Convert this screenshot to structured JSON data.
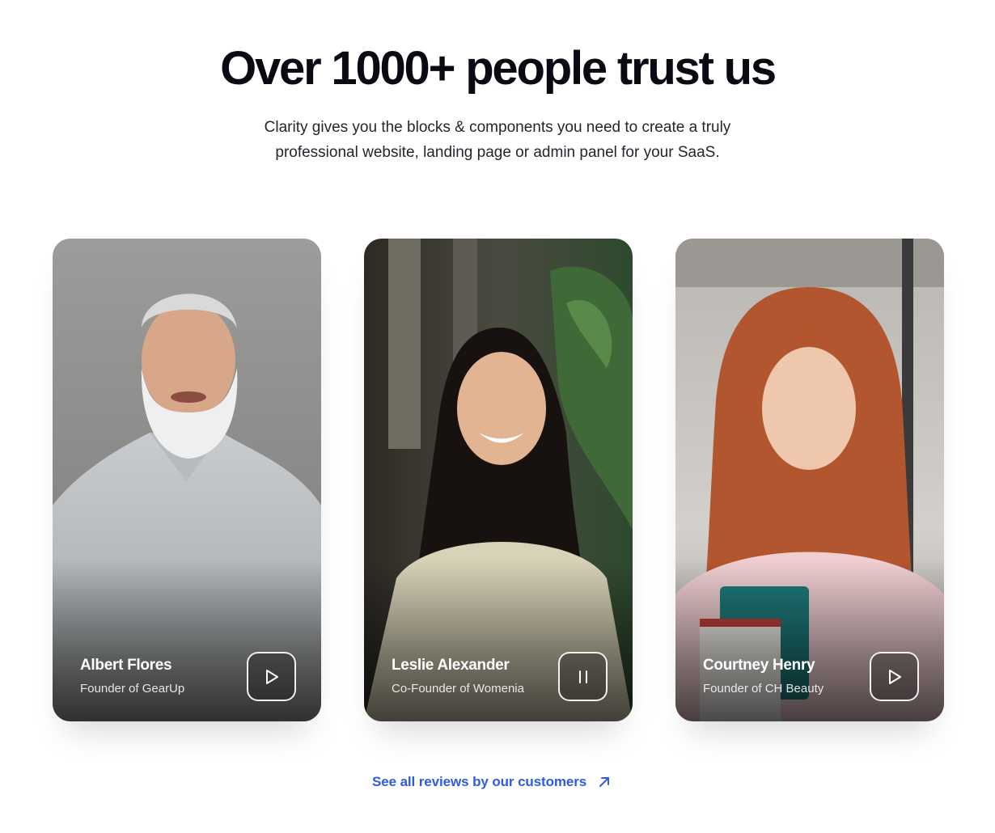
{
  "header": {
    "title": "Over 1000+ people trust us",
    "subtitle_line1": "Clarity gives you the blocks & components you need to create a truly",
    "subtitle_line2": "professional website, landing page or admin panel for your SaaS."
  },
  "testimonials": [
    {
      "name": "Albert Flores",
      "role": "Founder of GearUp",
      "media_state": "play",
      "media_icon": "play-icon"
    },
    {
      "name": "Leslie Alexander",
      "role": "Co-Founder of Womenia",
      "media_state": "pause",
      "media_icon": "pause-icon"
    },
    {
      "name": "Courtney Henry",
      "role": "Founder of CH Beauty",
      "media_state": "play",
      "media_icon": "play-icon"
    }
  ],
  "footer_link": {
    "label": "See all reviews by our customers",
    "icon": "arrow-up-right-icon"
  },
  "colors": {
    "link": "#2f5be0",
    "heading": "#0a0a12"
  }
}
